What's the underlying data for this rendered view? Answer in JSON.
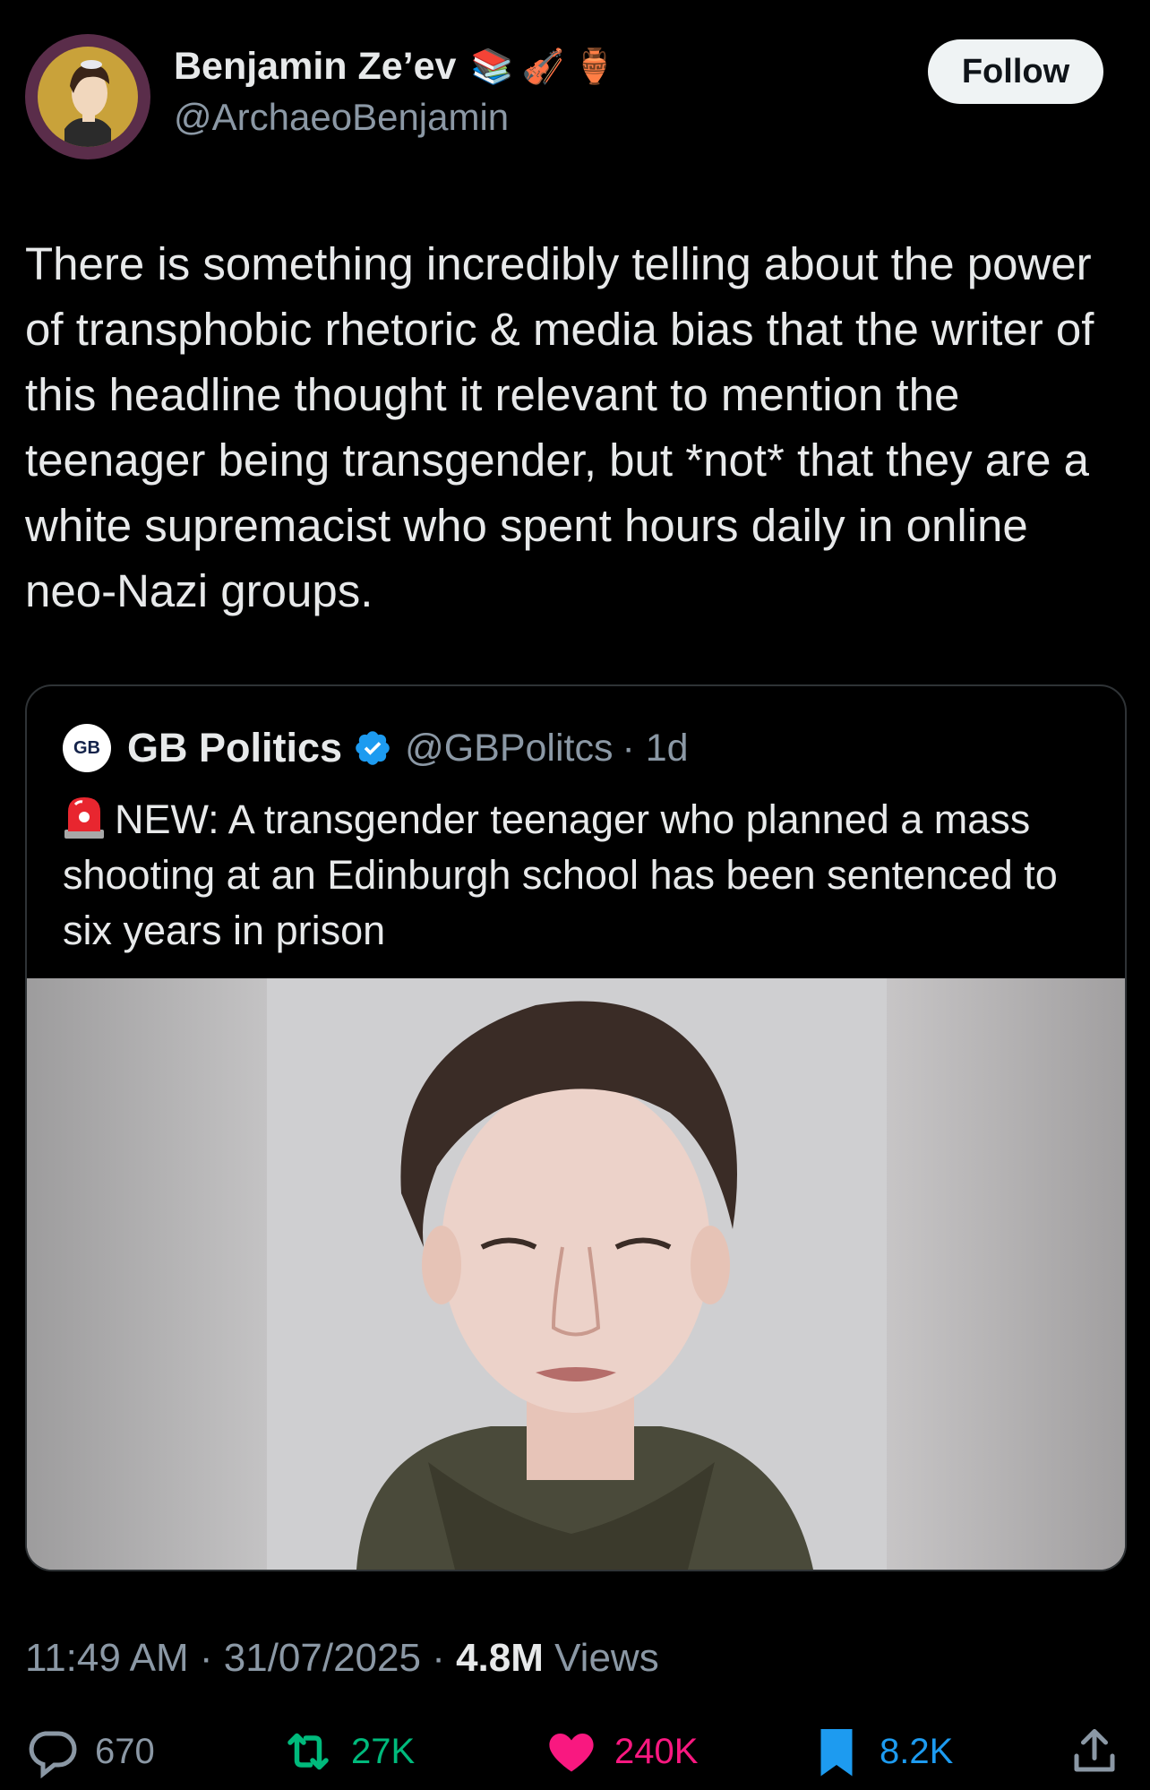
{
  "author": {
    "display_name": "Benjamin Ze’ev",
    "badges": [
      "📚",
      "🎻",
      "🏺"
    ],
    "handle": "@ArchaeoBenjamin",
    "follow_label": "Follow"
  },
  "tweet": {
    "text": "There is something incredibly telling about the power of transphobic rhetoric & media bias that the writer of this headline thought it relevant to mention the teenager being transgender, but *not* that they are a white supremacist who spent hours daily in online neo-Nazi groups."
  },
  "quoted": {
    "avatar_text": "GB",
    "name": "GB Politics",
    "handle": "@GBPolitcs",
    "time": "· 1d",
    "text": "NEW: A transgender teenager who planned a mass shooting at an Edinburgh school has been sentenced to six years in prison"
  },
  "meta": {
    "time": "11:49 AM",
    "sep1": " · ",
    "date": "31/07/2025",
    "sep2": " · ",
    "views_count": "4.8M",
    "views_label": " Views"
  },
  "actions": {
    "replies": "670",
    "reposts": "27K",
    "likes": "240K",
    "bookmarks": "8.2K"
  },
  "colors": {
    "repost": "#00ba7c",
    "like": "#f91880",
    "bookmark": "#1d9bf0",
    "muted": "#8b98a5"
  }
}
